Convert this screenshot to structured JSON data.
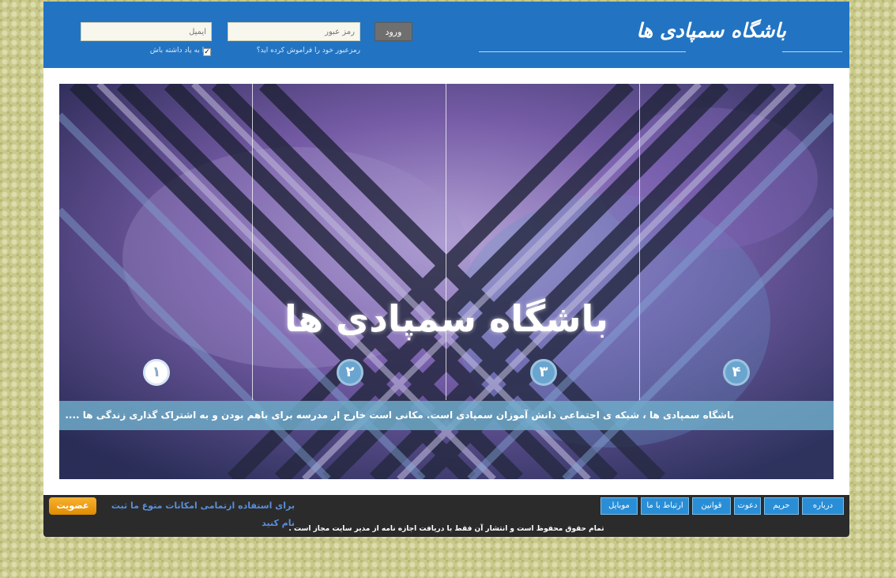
{
  "header": {
    "logo_text": "باشگاه سمپادی ها",
    "login_label": "ورود",
    "password_placeholder": "رمز عبور",
    "email_placeholder": "ایمیل",
    "forgot_text": "رمزعبور خود را فراموش کرده اید؟",
    "remember_text": "مرا به یاد داشته باش",
    "remember_checked": true
  },
  "hero": {
    "title": "باشگاه سمپادی ها",
    "slides": [
      "۱",
      "۲",
      "۳",
      "۴"
    ],
    "active_slide": 1,
    "caption": "باشگاه سمپادی ها ، شبکه ی اجتماعی دانش آموزان سمپادی است. مکانی است خارج از مدرسه برای باهم بودن و به اشتراک گذاری زندگی ها ...."
  },
  "footer": {
    "nav": [
      "درباره",
      "حریم",
      "دعوت",
      "قوانین",
      "ارتباط با ما",
      "موبایل"
    ],
    "promo_text": "برای استفاده ازتمامی امکانات متوع ما ثبت نام کنید",
    "join_label": "عضویت",
    "copyright": "تمام حقوق محفوظ است و انتشار آن فقط با دریافت اجازه نامه از مدیر سایت مجاز است ."
  },
  "colors": {
    "header_bg": "#2274c3",
    "nav_bg": "#2a8ed6",
    "join_bg": "#f0a000",
    "footer_bg": "#2b2b2b"
  }
}
